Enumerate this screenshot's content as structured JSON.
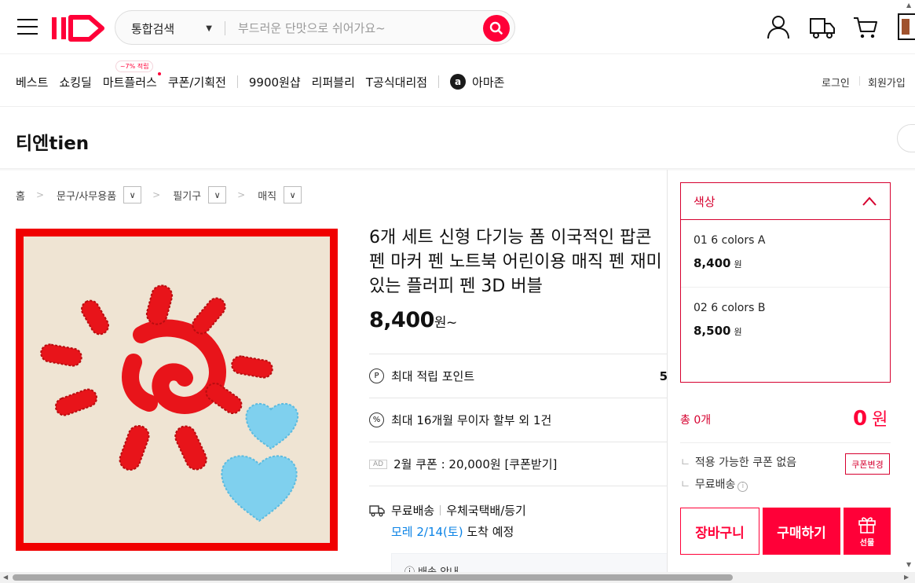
{
  "header": {
    "search_category": "통합검색",
    "search_placeholder": "부드러운 단맛으로 쉬어가요~"
  },
  "nav": {
    "items": [
      "베스트",
      "쇼킹딜",
      "마트플러스",
      "쿠폰/기획전",
      "9900원샵",
      "리퍼블리",
      "T공식대리점",
      "아마존"
    ],
    "mart_badge": "~7% 적립",
    "login": "로그인",
    "signup": "회원가입"
  },
  "store": {
    "name": "티엔tien"
  },
  "breadcrumb": {
    "home": "홈",
    "level1": "문구/사무용품",
    "level2": "필기구",
    "level3": "매직"
  },
  "product": {
    "title": "6개 세트 신형 다기능 폼 이국적인 팝콘 펜 마커 펜 노트북 어린이용 매직 펜 재미있는 플러피 펜 3D 버블",
    "price": "8,400",
    "price_unit": "원~",
    "max_point_label": "최대 적립 포인트",
    "max_point_value": "5",
    "installment_label": "최대 16개월 무이자 할부 외 1건",
    "ad_tag": "AD",
    "coupon_text": "2월 쿠폰 : 20,000원 [쿠폰받기]",
    "shipping_free": "무료배송",
    "shipping_method": "우체국택배/등기",
    "arrival_date": "모레 2/14(토)",
    "arrival_suffix": "도착 예정",
    "delivery_guide": "배송 안내"
  },
  "options": {
    "header": "색상",
    "items": [
      {
        "name": "01 6 colors A",
        "price": "8,400",
        "unit": "원"
      },
      {
        "name": "02 6 colors B",
        "price": "8,500",
        "unit": "원"
      }
    ]
  },
  "order": {
    "total_label": "총 0개",
    "total_value": "0",
    "total_unit": "원",
    "coupon_none": "적용 가능한 쿠폰 없음",
    "coupon_change": "쿠폰변경",
    "free_shipping": "무료배송",
    "cart_button": "장바구니",
    "buy_button": "구매하기",
    "gift_button": "선물"
  },
  "colors": {
    "brand": "#ff0038",
    "accent_dark": "#d6002f",
    "link_blue": "#0b83e6"
  },
  "icons": [
    "hamburger-icon",
    "search-icon",
    "user-icon",
    "truck-icon",
    "cart-icon",
    "point-icon",
    "percent-icon",
    "delivery-icon",
    "chevron-up-icon",
    "gift-icon",
    "info-icon"
  ]
}
